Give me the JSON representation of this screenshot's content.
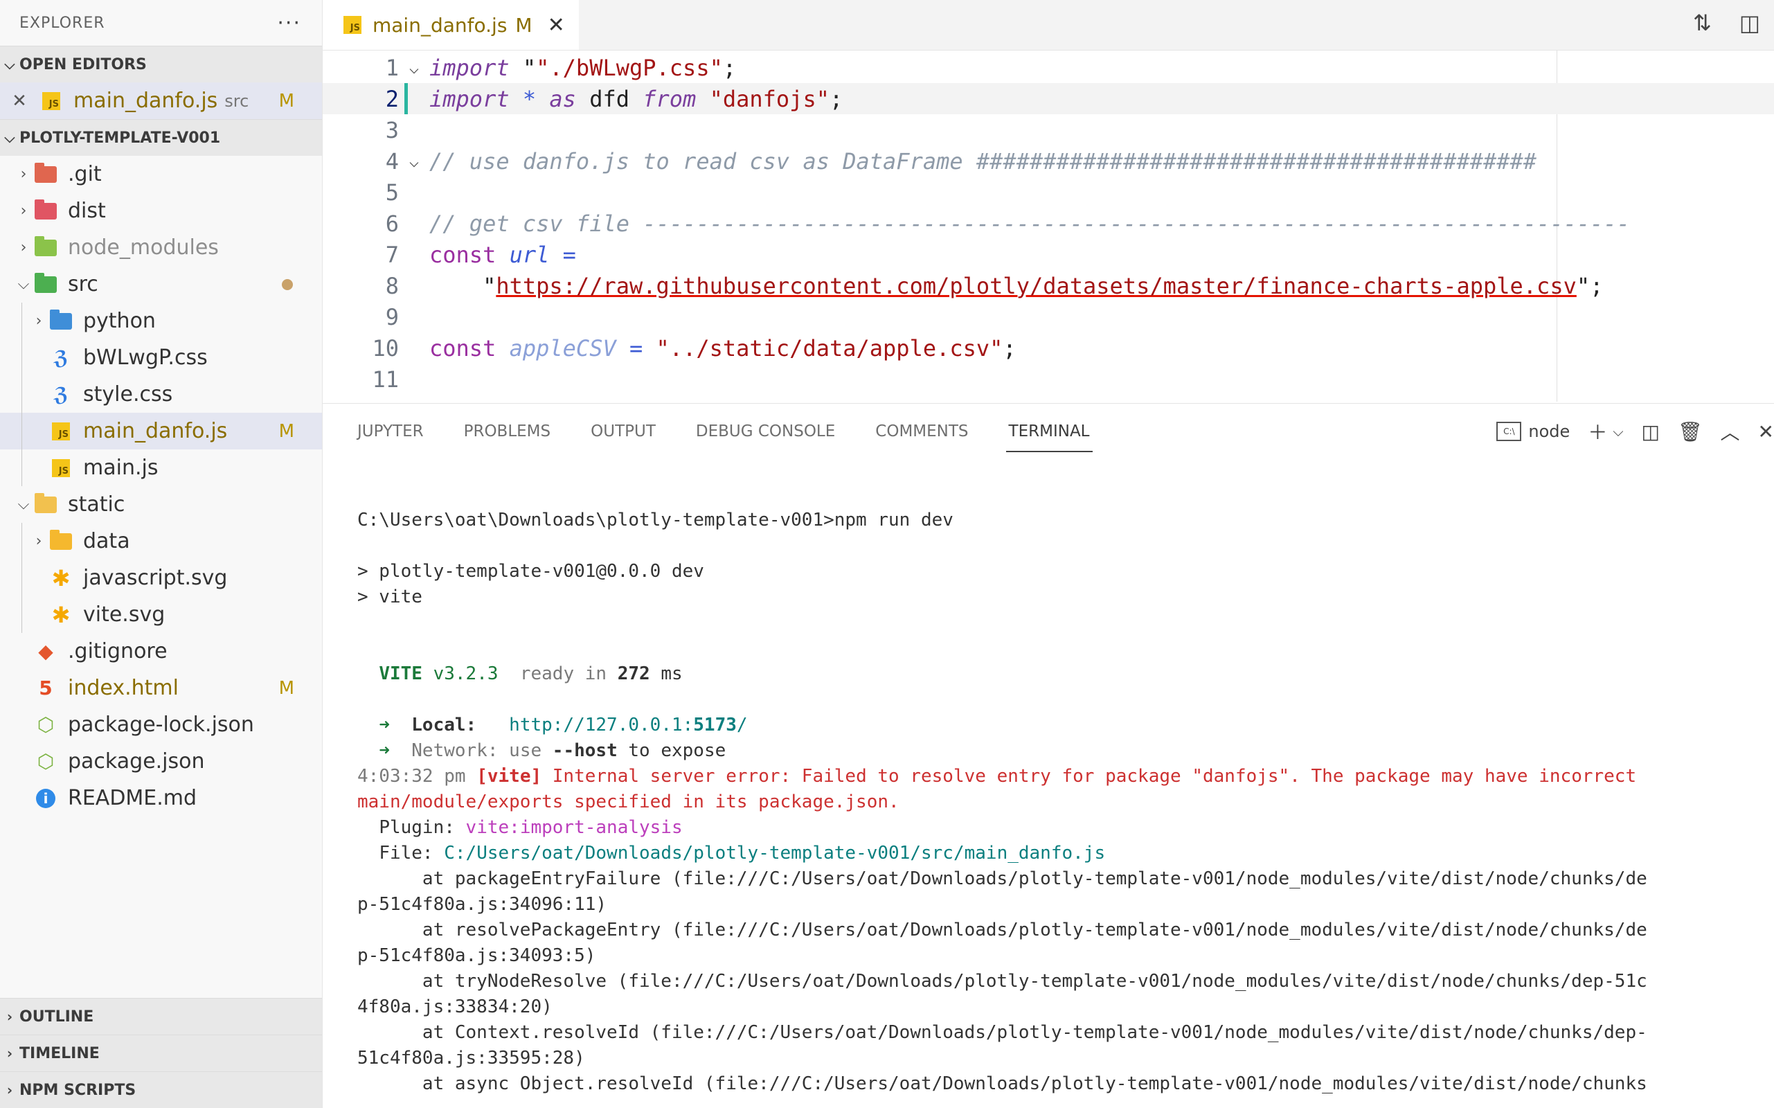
{
  "explorer": {
    "title": "EXPLORER",
    "more": "···",
    "open_editors": {
      "header": "OPEN EDITORS",
      "items": [
        {
          "close": "✕",
          "name": "main_danfo.js",
          "dir": "src",
          "badge": "M"
        }
      ]
    },
    "project": {
      "header": "PLOTLY-TEMPLATE-V001",
      "items": [
        {
          "name": ".git"
        },
        {
          "name": "dist"
        },
        {
          "name": "node_modules"
        },
        {
          "name": "src"
        },
        {
          "name": "python"
        },
        {
          "name": "bWLwgP.css"
        },
        {
          "name": "style.css"
        },
        {
          "name": "main_danfo.js",
          "badge": "M"
        },
        {
          "name": "main.js"
        },
        {
          "name": "static"
        },
        {
          "name": "data"
        },
        {
          "name": "javascript.svg"
        },
        {
          "name": "vite.svg"
        },
        {
          "name": ".gitignore"
        },
        {
          "name": "index.html",
          "badge": "M"
        },
        {
          "name": "package-lock.json"
        },
        {
          "name": "package.json"
        },
        {
          "name": "README.md"
        }
      ]
    },
    "bottom_sections": [
      "OUTLINE",
      "TIMELINE",
      "NPM SCRIPTS"
    ]
  },
  "editor_tab": {
    "name": "main_danfo.js",
    "badge": "M",
    "close": "✕"
  },
  "editor": {
    "line_numbers": [
      "1",
      "2",
      "3",
      "4",
      "5",
      "6",
      "7",
      "8",
      "9",
      "10",
      "11"
    ],
    "lines": {
      "l1_kw": "import",
      "l1_str": "\"./bWLwgP.css\"",
      "l1_end": ";",
      "l2_kw": "import",
      "l2_star": "*",
      "l2_as": "as",
      "l2_name": "dfd",
      "l2_from": "from",
      "l2_str": "\"danfojs\"",
      "l2_end": ";",
      "l4_comment": "// use danfo.js to read csv as DataFrame ##########################################",
      "l6_comment": "// get csv file --------------------------------------------------------------------------",
      "l7_const": "const",
      "l7_var": "url",
      "l7_eq": "=",
      "l8_q1": "\"",
      "l8_url": "https://raw.githubusercontent.com/plotly/datasets/master/finance-charts-apple.csv",
      "l8_q2": "\";",
      "l10_const": "const",
      "l10_var": "appleCSV",
      "l10_eq": "=",
      "l10_str": "\"../static/data/apple.csv\"",
      "l10_end": ";"
    }
  },
  "panel": {
    "tabs": [
      "JUPYTER",
      "PROBLEMS",
      "OUTPUT",
      "DEBUG CONSOLE",
      "COMMENTS",
      "TERMINAL"
    ],
    "active_tab": "TERMINAL",
    "terminal_name": "node",
    "terminal_icon_text": "C:\\"
  },
  "terminal": {
    "prompt": "C:\\Users\\oat\\Downloads\\plotly-template-v001>npm run dev",
    "script1": "> plotly-template-v001@0.0.0 dev",
    "script2": "> vite",
    "vite_name": "VITE",
    "vite_version": "v3.2.3",
    "ready_label": "ready in",
    "ready_ms": "272",
    "ms": "ms",
    "arrow": "➜",
    "local_label": "Local:",
    "local_url_base": "http://127.0.0.1:",
    "local_port": "5173",
    "local_url_end": "/",
    "network_label": "Network:",
    "network_use": "use",
    "network_host": "--host",
    "network_expose": "to expose",
    "err_time": "4:03:32 pm",
    "err_tag": "[vite]",
    "err_msg1": "Internal server error: Failed to resolve entry for package \"danfojs\". The package may have incorrect",
    "err_msg2": "main/module/exports specified in its package.json.",
    "plugin_label": "Plugin:",
    "plugin_value": "vite:import-analysis",
    "file_label": "File:",
    "file_value": "C:/Users/oat/Downloads/plotly-template-v001/src/main_danfo.js",
    "stack": [
      "      at packageEntryFailure (file:///C:/Users/oat/Downloads/plotly-template-v001/node_modules/vite/dist/node/chunks/de",
      "p-51c4f80a.js:34096:11)",
      "      at resolvePackageEntry (file:///C:/Users/oat/Downloads/plotly-template-v001/node_modules/vite/dist/node/chunks/de",
      "p-51c4f80a.js:34093:5)",
      "      at tryNodeResolve (file:///C:/Users/oat/Downloads/plotly-template-v001/node_modules/vite/dist/node/chunks/dep-51c",
      "4f80a.js:33834:20)",
      "      at Context.resolveId (file:///C:/Users/oat/Downloads/plotly-template-v001/node_modules/vite/dist/node/chunks/dep-",
      "51c4f80a.js:33595:28)",
      "      at async Object.resolveId (file:///C:/Users/oat/Downloads/plotly-template-v001/node_modules/vite/dist/node/chunks"
    ]
  },
  "colors": {
    "accent": "#007acc",
    "modified": "#8a6d00",
    "error": "#cd3131",
    "success": "#1b7a3a"
  }
}
